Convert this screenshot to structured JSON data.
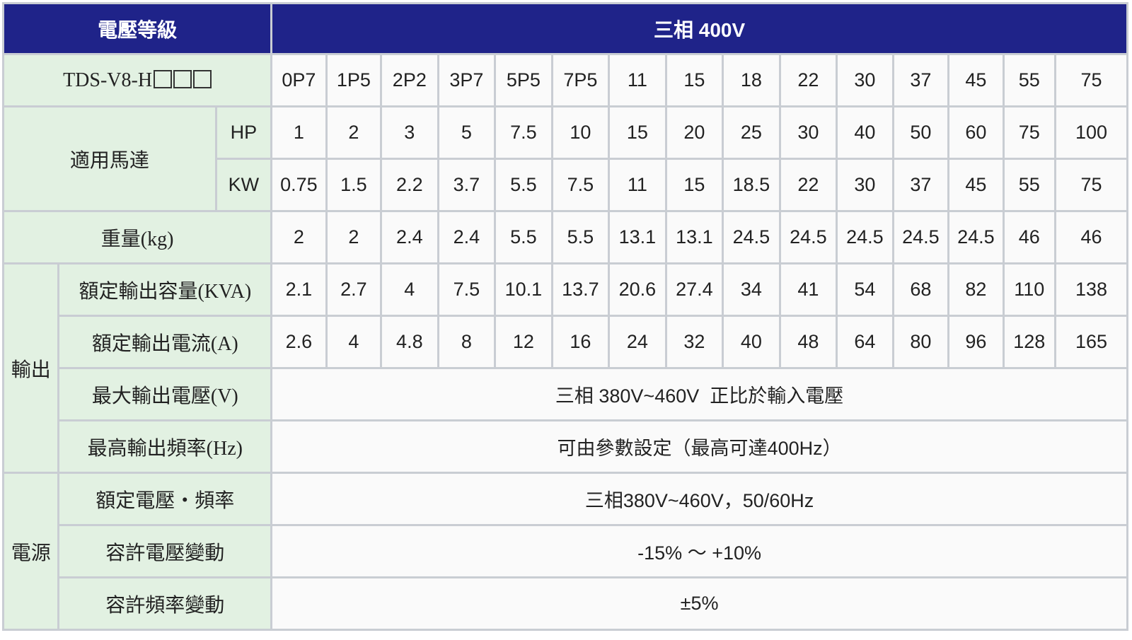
{
  "header": {
    "voltage_class_label": "電壓等級",
    "voltage_class_value": "三相 400V"
  },
  "model": {
    "label_prefix": "TDS-V8-H",
    "placeholder_boxes": 3,
    "codes": [
      "0P7",
      "1P5",
      "2P2",
      "3P7",
      "5P5",
      "7P5",
      "11",
      "15",
      "18",
      "22",
      "30",
      "37",
      "45",
      "55",
      "75"
    ]
  },
  "motor": {
    "label": "適用馬達",
    "hp_label": "HP",
    "hp": [
      "1",
      "2",
      "3",
      "5",
      "7.5",
      "10",
      "15",
      "20",
      "25",
      "30",
      "40",
      "50",
      "60",
      "75",
      "100"
    ],
    "kw_label": "KW",
    "kw": [
      "0.75",
      "1.5",
      "2.2",
      "3.7",
      "5.5",
      "7.5",
      "11",
      "15",
      "18.5",
      "22",
      "30",
      "37",
      "45",
      "55",
      "75"
    ]
  },
  "weight": {
    "label": "重量(kg)",
    "values": [
      "2",
      "2",
      "2.4",
      "2.4",
      "5.5",
      "5.5",
      "13.1",
      "13.1",
      "24.5",
      "24.5",
      "24.5",
      "24.5",
      "24.5",
      "46",
      "46"
    ]
  },
  "output": {
    "group_label": "輸出",
    "capacity_label": "額定輸出容量(KVA)",
    "capacity": [
      "2.1",
      "2.7",
      "4",
      "7.5",
      "10.1",
      "13.7",
      "20.6",
      "27.4",
      "34",
      "41",
      "54",
      "68",
      "82",
      "110",
      "138"
    ],
    "current_label": "額定輸出電流(A)",
    "current": [
      "2.6",
      "4",
      "4.8",
      "8",
      "12",
      "16",
      "24",
      "32",
      "40",
      "48",
      "64",
      "80",
      "96",
      "128",
      "165"
    ],
    "max_voltage_label": "最大輸出電壓(V)",
    "max_voltage_value": "三相 380V~460V  正比於輸入電壓",
    "max_freq_label": "最高輸出頻率(Hz)",
    "max_freq_value": "可由參數設定（最高可達400Hz）"
  },
  "power": {
    "group_label": "電源",
    "rated_label": "額定電壓・頻率",
    "rated_value": "三相380V~460V，50/60Hz",
    "voltage_tol_label": "容許電壓變動",
    "voltage_tol_value": "-15% ～ +10%",
    "freq_tol_label": "容許頻率變動",
    "freq_tol_value": "±5%"
  },
  "colors": {
    "header_bg": "#1f2389",
    "label_bg": "#e2f1e2",
    "value_bg": "#fafafa",
    "border": "#c9cdd3"
  }
}
